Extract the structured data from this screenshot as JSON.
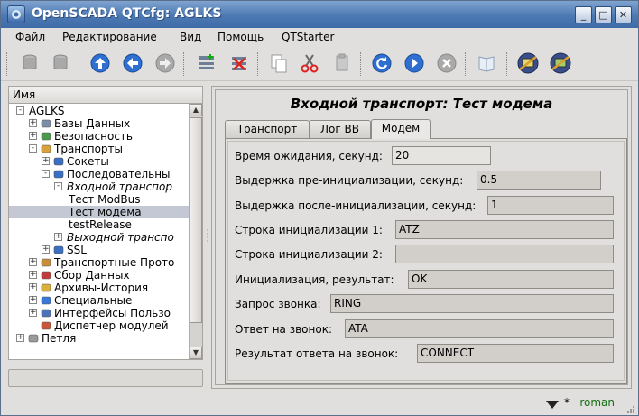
{
  "window": {
    "title": "OpenSCADA QTCfg: AGLKS",
    "buttons": {
      "minimize": "_",
      "maximize": "□",
      "close": "✕"
    }
  },
  "menubar": {
    "items": [
      {
        "label": "Файл"
      },
      {
        "label": "Редактирование"
      },
      {
        "label": "Вид"
      },
      {
        "label": "Помощь"
      },
      {
        "label": "QTStarter"
      }
    ]
  },
  "toolbar": {
    "buttons": [
      "db-load-icon",
      "db-save-icon",
      "up-icon",
      "back-icon",
      "forward-icon",
      "add-item-icon",
      "delete-item-icon",
      "copy-icon",
      "cut-icon",
      "paste-icon",
      "reload-icon",
      "start-icon",
      "stop-icon",
      "manual-icon",
      "ui-vision-icon",
      "ui-vision-run-icon"
    ]
  },
  "tree": {
    "header": "Имя",
    "items": [
      {
        "label": "AGLKS",
        "level": 0,
        "expander": "−",
        "icon": "none"
      },
      {
        "label": "Базы Данных",
        "level": 1,
        "expander": "+",
        "icon": "db-icon"
      },
      {
        "label": "Безопасность",
        "level": 1,
        "expander": "+",
        "icon": "security-icon"
      },
      {
        "label": "Транспорты",
        "level": 1,
        "expander": "−",
        "icon": "transport-icon"
      },
      {
        "label": "Сокеты",
        "level": 2,
        "expander": "+",
        "icon": "module-icon"
      },
      {
        "label": "Последовательны",
        "level": 2,
        "expander": "−",
        "icon": "module-icon"
      },
      {
        "label": "Входной транспор",
        "level": 3,
        "expander": "−",
        "icon": "none",
        "italic": true
      },
      {
        "label": "Тест ModBus",
        "level": 4,
        "expander": "",
        "icon": "none"
      },
      {
        "label": "Тест модема",
        "level": 4,
        "expander": "",
        "icon": "none",
        "selected": true
      },
      {
        "label": "testRelease",
        "level": 4,
        "expander": "",
        "icon": "none"
      },
      {
        "label": "Выходной транспо",
        "level": 3,
        "expander": "+",
        "icon": "none",
        "italic": true
      },
      {
        "label": "SSL",
        "level": 2,
        "expander": "+",
        "icon": "module-icon"
      },
      {
        "label": "Транспортные Прото",
        "level": 1,
        "expander": "+",
        "icon": "protocol-icon"
      },
      {
        "label": "Сбор Данных",
        "level": 1,
        "expander": "+",
        "icon": "daq-icon"
      },
      {
        "label": "Архивы-История",
        "level": 1,
        "expander": "+",
        "icon": "archive-icon"
      },
      {
        "label": "Специальные",
        "level": 1,
        "expander": "+",
        "icon": "special-icon"
      },
      {
        "label": "Интерфейсы Пользо",
        "level": 1,
        "expander": "+",
        "icon": "ui-icon"
      },
      {
        "label": "Диспетчер модулей",
        "level": 1,
        "expander": "",
        "icon": "modules-icon"
      },
      {
        "label": "Петля",
        "level": 0,
        "expander": "+",
        "icon": "loop-icon"
      }
    ]
  },
  "panel": {
    "title": "Входной транспорт: Тест модема",
    "tabs": [
      {
        "label": "Транспорт"
      },
      {
        "label": "Лог ВВ"
      },
      {
        "label": "Модем",
        "active": true
      }
    ],
    "fields": [
      {
        "label": "Время ожидания, секунд:",
        "value": "20",
        "editable": true
      },
      {
        "label": "Выдержка пре-инициализации, секунд:",
        "value": "0.5",
        "editable": true
      },
      {
        "label": "Выдержка после-инициализации, секунд:",
        "value": "1",
        "editable": true
      },
      {
        "label": "Строка инициализации 1:",
        "value": "ATZ",
        "editable": true
      },
      {
        "label": "Строка инициализации 2:",
        "value": "",
        "editable": true
      },
      {
        "label": "Инициализация, результат:",
        "value": "OK",
        "editable": true
      },
      {
        "label": "Запрос звонка:",
        "value": "RING",
        "editable": true
      },
      {
        "label": "Ответ на звонок:",
        "value": "ATA",
        "editable": true
      },
      {
        "label": "Результат ответа на звонок:",
        "value": "CONNECT",
        "editable": true
      }
    ]
  },
  "statusbar": {
    "modified_mark": "*",
    "user": "roman"
  },
  "colors": {
    "titlebar": "#4d79b3",
    "selection": "#c3c8d4",
    "user_text": "#126e12"
  }
}
